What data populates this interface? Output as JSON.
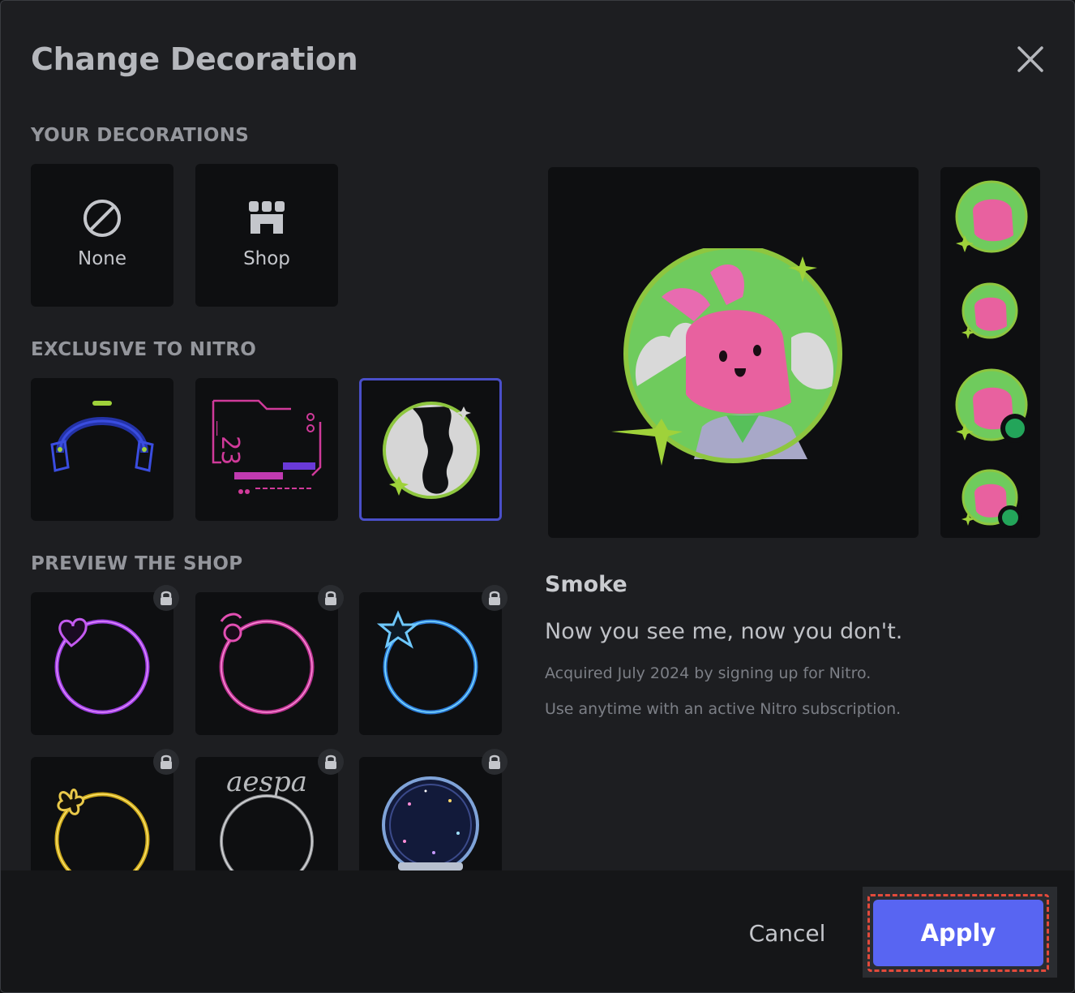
{
  "dialog": {
    "title": "Change Decoration",
    "close_icon": "close-icon"
  },
  "sections": {
    "your_decorations": "YOUR DECORATIONS",
    "exclusive": "EXCLUSIVE TO NITRO",
    "preview_shop": "PREVIEW THE SHOP"
  },
  "your_decorations": [
    {
      "label": "None",
      "icon": "none-icon"
    },
    {
      "label": "Shop",
      "icon": "shop-icon"
    }
  ],
  "exclusive_items": [
    {
      "icon": "headphones-decoration-icon"
    },
    {
      "icon": "cyber-23-decoration-icon"
    },
    {
      "icon": "smoke-decoration-icon",
      "selected": true
    }
  ],
  "shop_items": [
    {
      "icon": "heart-ring-decoration-icon",
      "locked": true
    },
    {
      "icon": "moon-ring-decoration-icon",
      "locked": true
    },
    {
      "icon": "star-ring-decoration-icon",
      "locked": true
    },
    {
      "icon": "butterfly-ring-decoration-icon",
      "locked": true
    },
    {
      "icon": "aespa-ring-decoration-icon",
      "label": "aespa",
      "locked": true
    },
    {
      "icon": "snow-globe-decoration-icon",
      "locked": true
    }
  ],
  "selected_decoration": {
    "name": "Smoke",
    "description": "Now you see me, now you don't.",
    "acquired": "Acquired July 2024 by signing up for Nitro.",
    "usage": "Use anytime with an active Nitro subscription."
  },
  "footer": {
    "cancel_label": "Cancel",
    "apply_label": "Apply"
  },
  "colors": {
    "accent": "#5865f2",
    "selected_border": "#4a4fc9",
    "highlight_outline": "#e24a3b",
    "online_status": "#23a55a"
  }
}
